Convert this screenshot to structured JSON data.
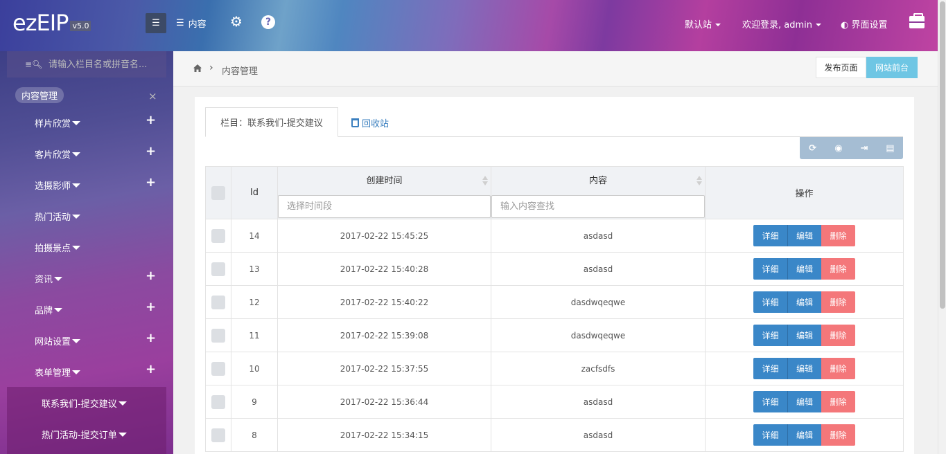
{
  "topbar": {
    "logo": "ezEIP",
    "version": "v5.0",
    "content_label": "内容",
    "site_label": "默认站",
    "welcome_label": "欢迎登录, admin",
    "ui_settings_label": "界面设置",
    "colors": {
      "accent": "#3a87c8",
      "danger": "#f4777a",
      "info": "#6ec6e4"
    }
  },
  "sidebar": {
    "search_placeholder": "请输入栏目名或拼音名...",
    "section_label": "内容管理",
    "items": [
      {
        "label": "样片欣赏",
        "has_plus": true
      },
      {
        "label": "客片欣赏",
        "has_plus": true
      },
      {
        "label": "选摄影师",
        "has_plus": true
      },
      {
        "label": "热门活动",
        "has_plus": false
      },
      {
        "label": "拍摄景点",
        "has_plus": false
      },
      {
        "label": "资讯",
        "has_plus": true
      },
      {
        "label": "品牌",
        "has_plus": true
      },
      {
        "label": "网站设置",
        "has_plus": true
      },
      {
        "label": "表单管理",
        "has_plus": true
      }
    ],
    "sub_items": [
      {
        "label": "联系我们-提交建议"
      },
      {
        "label": "热门活动-提交订单"
      }
    ]
  },
  "breadcrumb": {
    "current": "内容管理",
    "publish_label": "发布页面",
    "front_label": "网站前台"
  },
  "tabs": {
    "active_label": "栏目：联系我们-提交建议",
    "recycle_label": "回收站"
  },
  "table": {
    "headers": {
      "id": "Id",
      "created": "创建时间",
      "content": "内容",
      "ops": "操作"
    },
    "filters": {
      "created_placeholder": "选择时间段",
      "content_placeholder": "输入内容查找"
    },
    "op_labels": {
      "detail": "详细",
      "edit": "编辑",
      "delete": "删除"
    },
    "rows": [
      {
        "id": "14",
        "created": "2017-02-22 15:45:25",
        "content": "asdasd"
      },
      {
        "id": "13",
        "created": "2017-02-22 15:40:28",
        "content": "asdasd"
      },
      {
        "id": "12",
        "created": "2017-02-22 15:40:22",
        "content": "dasdwqeqwe"
      },
      {
        "id": "11",
        "created": "2017-02-22 15:39:08",
        "content": "dasdwqeqwe"
      },
      {
        "id": "10",
        "created": "2017-02-22 15:37:55",
        "content": "zacfsdfs"
      },
      {
        "id": "9",
        "created": "2017-02-22 15:36:44",
        "content": "asdasd"
      },
      {
        "id": "8",
        "created": "2017-02-22 15:34:15",
        "content": "asdasd"
      }
    ]
  }
}
